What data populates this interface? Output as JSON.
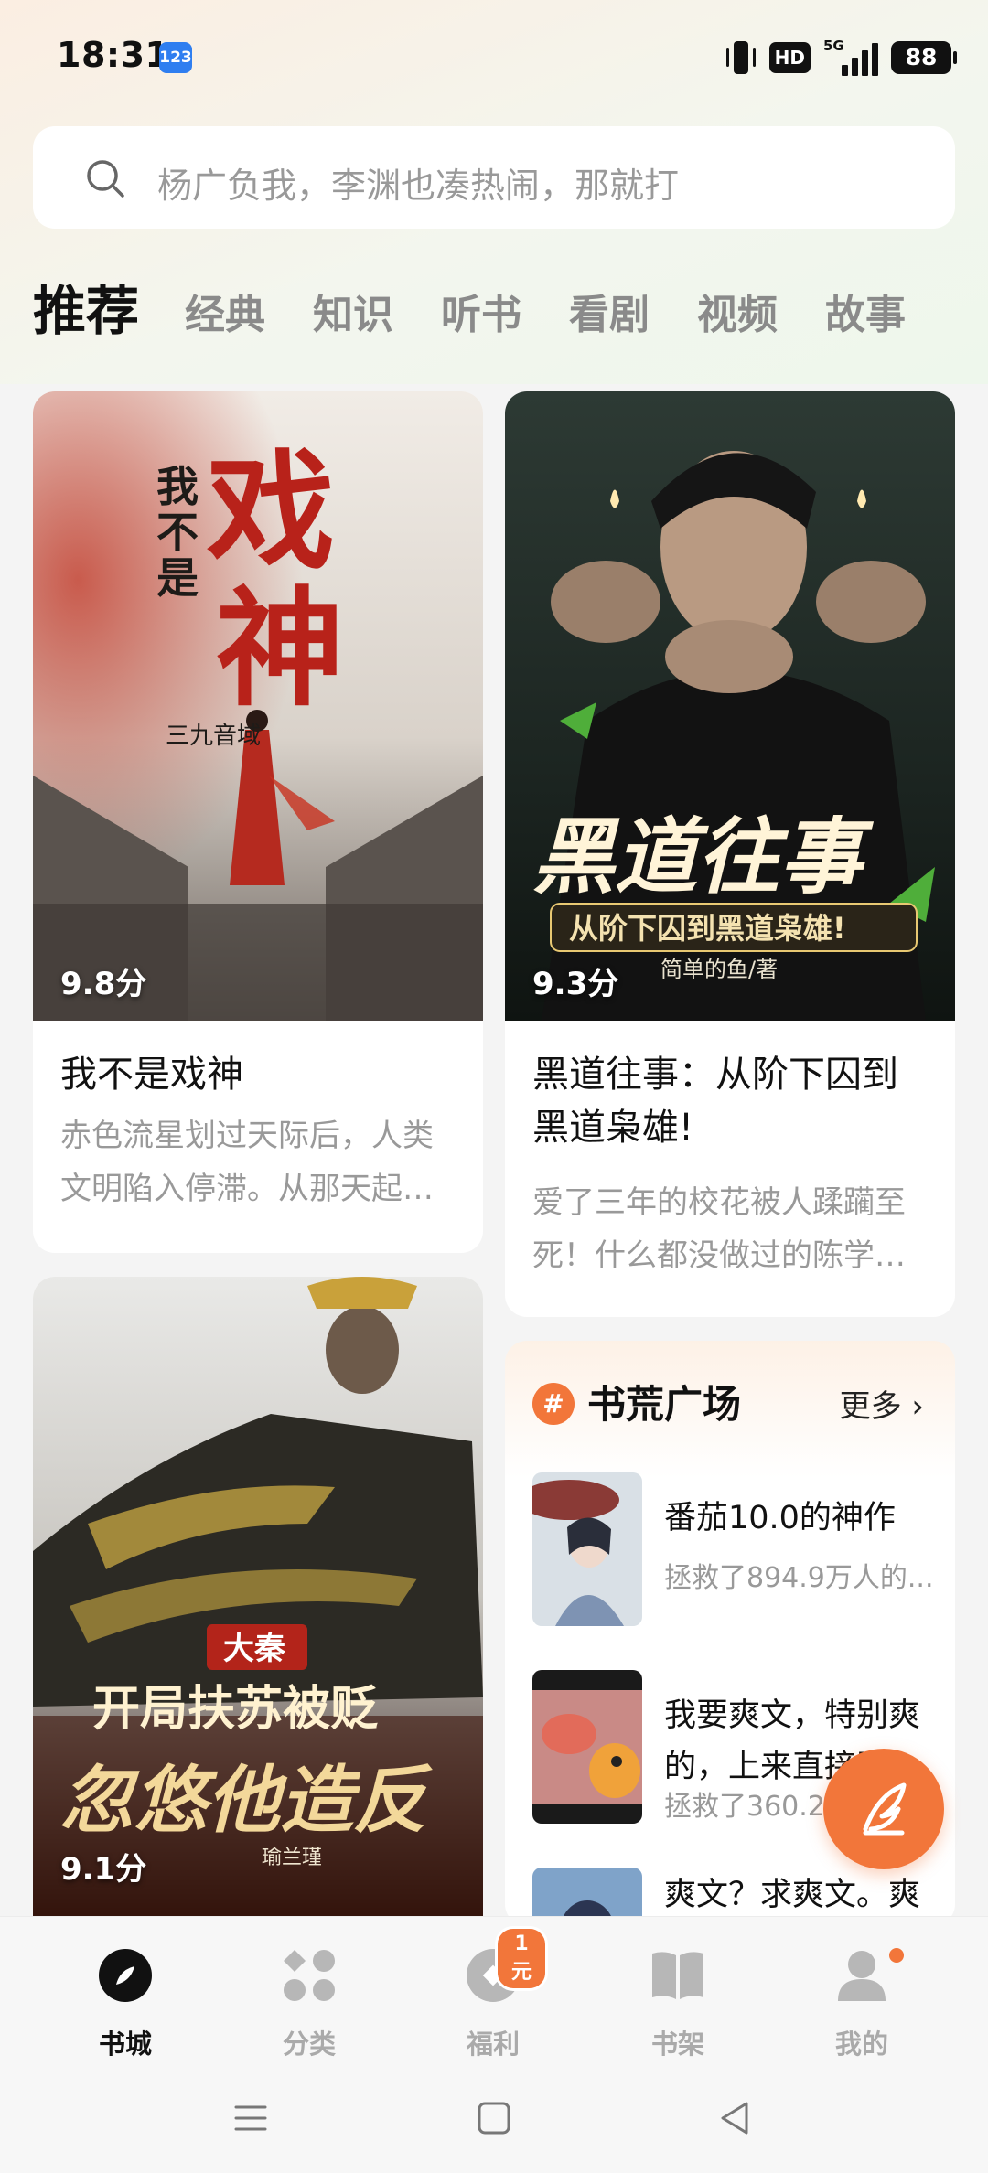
{
  "status_bar": {
    "time": "18:31",
    "keyboard_badge": "123",
    "hd": "HD",
    "network": "5G",
    "battery": "88"
  },
  "search": {
    "placeholder": "杨广负我，李渊也凑热闹，那就打"
  },
  "tabs": [
    "推荐",
    "经典",
    "知识",
    "听书",
    "看剧",
    "视频",
    "故事"
  ],
  "books": [
    {
      "title": "我不是戏神",
      "score": "9.8分",
      "desc": "赤色流星划过天际后，人类文明陷入停滞。从那天起…",
      "cover_title": "我不是戏神",
      "cover_author": "三九音域"
    },
    {
      "title": "黑道往事：从阶下囚到黑道枭雄!",
      "score": "9.3分",
      "desc": "爱了三年的校花被人蹂躏至死！什么都没做过的陈学…",
      "cover_title": "黑道往事",
      "cover_subtitle": "从阶下囚到黑道枭雄!",
      "cover_author": "简单的鱼/著"
    },
    {
      "score": "9.1分",
      "cover_tag": "大秦",
      "cover_title": "开局扶苏被贬",
      "cover_title2": "忽悠他造反",
      "cover_author": "瑜兰瑾"
    }
  ],
  "plaza": {
    "hash_icon": "#",
    "title": "书荒广场",
    "more": "更多",
    "items": [
      {
        "title": "番茄10.0的神作",
        "sub": "拯救了894.9万人的..."
      },
      {
        "title": "我要爽文，特别爽的，上来直接开",
        "sub": "拯救了360.2万"
      },
      {
        "title": "爽文？求爽文。爽"
      }
    ]
  },
  "nav": {
    "items": [
      {
        "label": "书城",
        "icon": "compass-icon"
      },
      {
        "label": "分类",
        "icon": "category-icon"
      },
      {
        "label": "福利",
        "icon": "gift-icon",
        "badge": "1元"
      },
      {
        "label": "书架",
        "icon": "bookshelf-icon"
      },
      {
        "label": "我的",
        "icon": "profile-icon"
      }
    ]
  },
  "colors": {
    "accent": "#f2763a",
    "text_primary": "#111111",
    "text_secondary": "#999999"
  }
}
